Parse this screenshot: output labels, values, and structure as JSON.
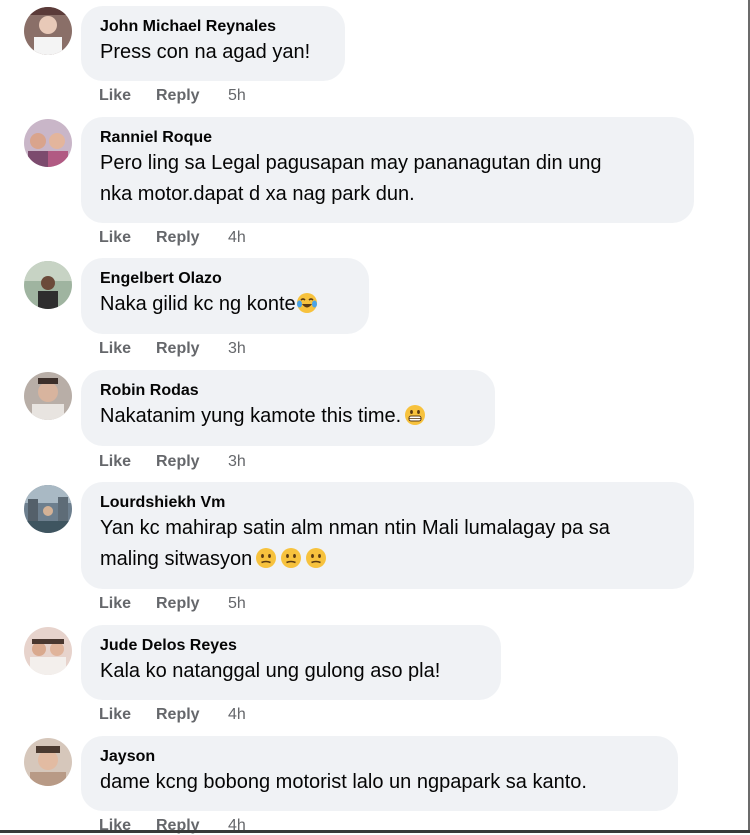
{
  "comments": [
    {
      "author": "John Michael Reynales",
      "lines": [
        "Press con na agad yan!"
      ],
      "like": "Like",
      "reply": "Reply",
      "time": "5h",
      "emoji": []
    },
    {
      "author": "Ranniel Roque",
      "lines": [
        "Pero ling sa Legal pagusapan may pananagutan din ung",
        "nka motor.dapat d xa nag park dun."
      ],
      "like": "Like",
      "reply": "Reply",
      "time": "4h",
      "emoji": []
    },
    {
      "author": "Engelbert Olazo",
      "lines": [
        "Naka gilid kc ng konte"
      ],
      "like": "Like",
      "reply": "Reply",
      "time": "3h",
      "emoji": [
        "tears-of-joy"
      ]
    },
    {
      "author": "Robin Rodas",
      "lines": [
        "Nakatanim yung kamote this time."
      ],
      "like": "Like",
      "reply": "Reply",
      "time": "3h",
      "emoji": [
        "grimacing"
      ]
    },
    {
      "author": "Lourdshiekh Vm",
      "lines": [
        "Yan kc mahirap satin alm nman ntin Mali lumalagay pa sa",
        "maling sitwasyon"
      ],
      "like": "Like",
      "reply": "Reply",
      "time": "5h",
      "emoji": [
        "neutral",
        "neutral",
        "neutral"
      ]
    },
    {
      "author": "Jude Delos Reyes",
      "lines": [
        "Kala ko natanggal ung gulong aso pla!"
      ],
      "like": "Like",
      "reply": "Reply",
      "time": "4h",
      "emoji": []
    },
    {
      "author": "Jayson",
      "lines": [
        "dame kcng bobong motorist lalo un ngpapark sa kanto."
      ],
      "like": "Like",
      "reply": "Reply",
      "time": "4h",
      "emoji": []
    }
  ]
}
